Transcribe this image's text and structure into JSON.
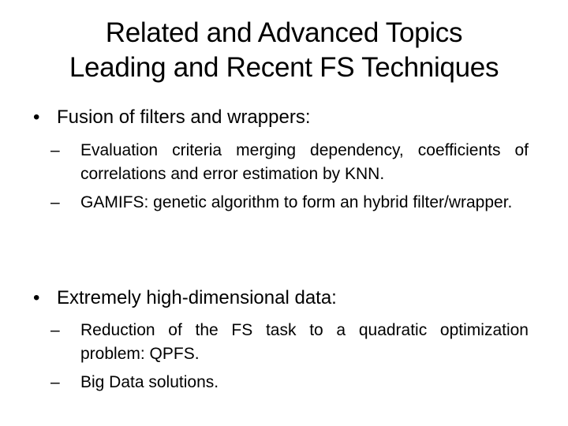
{
  "slide": {
    "title_lines": [
      "Related and Advanced Topics",
      "Leading and Recent FS Techniques"
    ],
    "bullets": [
      {
        "marker": "•",
        "text": "Fusion of filters and wrappers:",
        "sub_items": [
          {
            "marker": "–",
            "text": "Evaluation criteria merging dependency, coefficients of correlations and error estimation by KNN."
          },
          {
            "marker": "–",
            "text": "GAMIFS: genetic algorithm to form an hybrid filter/wrapper."
          }
        ]
      },
      {
        "marker": "•",
        "text": "Extremely high-dimensional data:",
        "sub_items": [
          {
            "marker": "–",
            "text": "Reduction of the FS task to a quadratic optimization problem: QPFS."
          },
          {
            "marker": "–",
            "text": "Big Data solutions."
          }
        ]
      }
    ]
  }
}
